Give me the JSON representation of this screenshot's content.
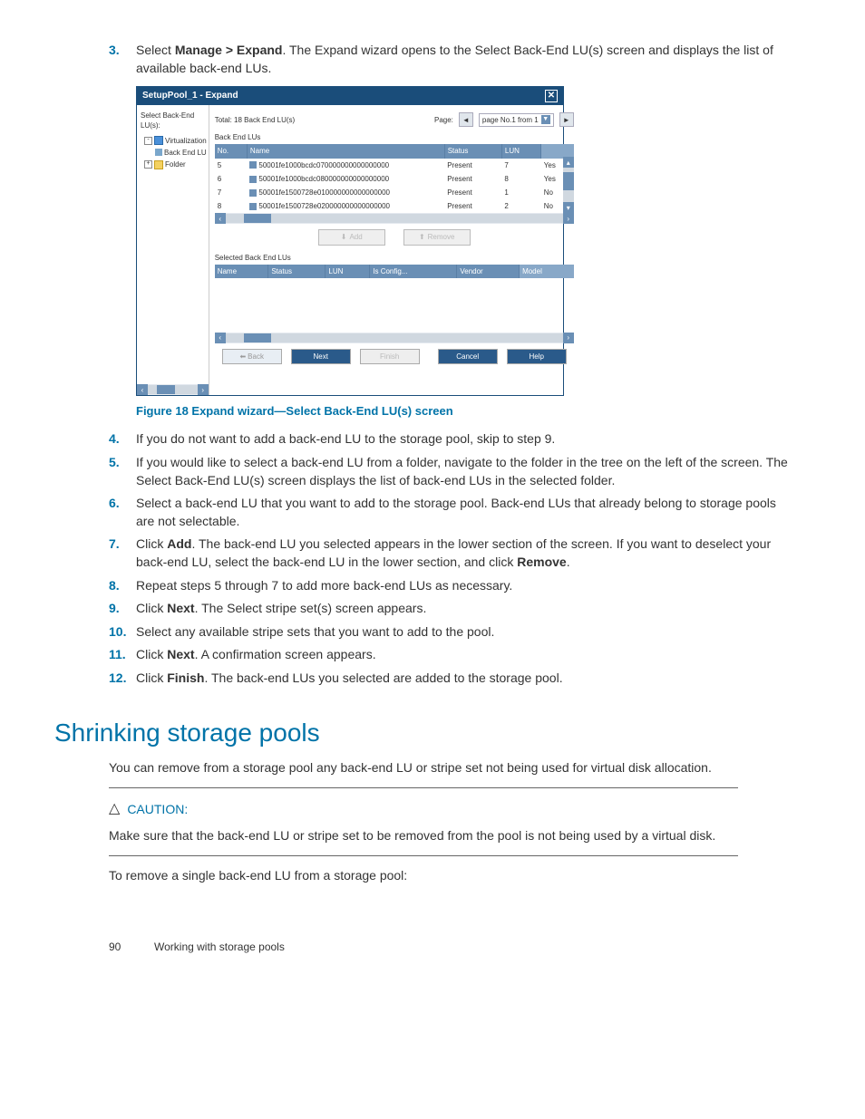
{
  "steps_top": {
    "n3": "3.",
    "t3a": "Select ",
    "t3b": "Manage > Expand",
    "t3c": ". The Expand wizard opens to the Select Back-End LU(s) screen and displays the list of available back-end LUs."
  },
  "wizard": {
    "title": "SetupPool_1 - Expand",
    "left_label": "Select Back-End LU(s):",
    "tree": {
      "virt": "Virtualization",
      "backend": "Back End LU",
      "folder": "Folder"
    },
    "total": "Total: 18 Back End LU(s)",
    "page_label": "Page:",
    "page_value": "page No.1 from 1",
    "tbl1_label": "Back End LUs",
    "hdr": {
      "no": "No.",
      "name": "Name",
      "status": "Status",
      "lun": "LUN",
      "extra": ""
    },
    "rows": [
      {
        "no": "5",
        "name": "50001fe1000bcdc070000000000000000",
        "status": "Present",
        "lun": "7",
        "extra": "Yes"
      },
      {
        "no": "6",
        "name": "50001fe1000bcdc080000000000000000",
        "status": "Present",
        "lun": "8",
        "extra": "Yes"
      },
      {
        "no": "7",
        "name": "50001fe1500728e010000000000000000",
        "status": "Present",
        "lun": "1",
        "extra": "No"
      },
      {
        "no": "8",
        "name": "50001fe1500728e020000000000000000",
        "status": "Present",
        "lun": "2",
        "extra": "No"
      }
    ],
    "add": "Add",
    "remove": "Remove",
    "tbl2_label": "Selected Back End LUs",
    "hdr2": {
      "name": "Name",
      "status": "Status",
      "lun": "LUN",
      "config": "Is Config...",
      "vendor": "Vendor",
      "model": "Model"
    },
    "back": "Back",
    "next": "Next",
    "finish": "Finish",
    "cancel": "Cancel",
    "help": "Help"
  },
  "fig_caption": "Figure 18 Expand wizard—Select Back-End LU(s) screen",
  "steps": {
    "n4": "4.",
    "t4": "If you do not want to add a back-end LU to the storage pool, skip to step 9.",
    "n5": "5.",
    "t5": "If you would like to select a back-end LU from a folder, navigate to the folder in the tree on the left of the screen. The Select Back-End LU(s) screen displays the list of back-end LUs in the selected folder.",
    "n6": "6.",
    "t6": "Select a back-end LU that you want to add to the storage pool. Back-end LUs that already belong to storage pools are not selectable.",
    "n7": "7.",
    "t7a": "Click ",
    "t7b": "Add",
    "t7c": ". The back-end LU you selected appears in the lower section of the screen. If you want to deselect your back-end LU, select the back-end LU in the lower section, and click ",
    "t7d": "Remove",
    "t7e": ".",
    "n8": "8.",
    "t8": "Repeat steps 5 through 7 to add more back-end LUs as necessary.",
    "n9": "9.",
    "t9a": "Click ",
    "t9b": "Next",
    "t9c": ". The Select stripe set(s) screen appears.",
    "n10": "10.",
    "t10": "Select any available stripe sets that you want to add to the pool.",
    "n11": "11.",
    "t11a": "Click ",
    "t11b": "Next",
    "t11c": ". A confirmation screen appears.",
    "n12": "12.",
    "t12a": "Click ",
    "t12b": "Finish",
    "t12c": ". The back-end LUs you selected are added to the storage pool."
  },
  "h2": "Shrinking storage pools",
  "para1": "You can remove from a storage pool any back-end LU or stripe set not being used for virtual disk allocation.",
  "caution_label": "CAUTION:",
  "caution_text": "Make sure that the back-end LU or stripe set to be removed from the pool is not being used by a virtual disk.",
  "para2": "To remove a single back-end LU from a storage pool:",
  "footer_page": "90",
  "footer_text": "Working with storage pools"
}
